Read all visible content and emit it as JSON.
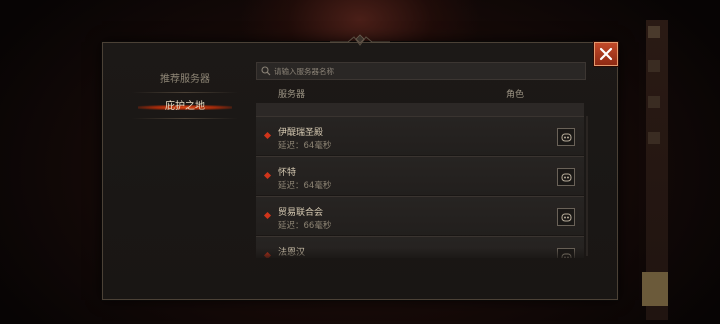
{
  "sidebar": {
    "items": [
      {
        "label": "推荐服务器",
        "selected": false
      },
      {
        "label": "庇护之地",
        "selected": true
      }
    ]
  },
  "search": {
    "placeholder": "请输入服务器名称",
    "icon": "search-icon"
  },
  "list": {
    "headers": {
      "server": "服务器",
      "role": "角色"
    },
    "rows": [
      {
        "name": "伊醍瑞圣殿",
        "latency": "延迟：64毫秒"
      },
      {
        "name": "怀特",
        "latency": "延迟：64毫秒"
      },
      {
        "name": "贸易联合会",
        "latency": "延迟：66毫秒"
      },
      {
        "name": "法恩汉",
        "latency": ""
      }
    ]
  },
  "close": {
    "icon": "close-icon"
  },
  "colors": {
    "accent_red": "#d0341a",
    "close_button": "#b03c1e",
    "panel_bg": "#1c1917",
    "text_primary": "#d8ccb4",
    "text_muted": "#8d8474"
  }
}
